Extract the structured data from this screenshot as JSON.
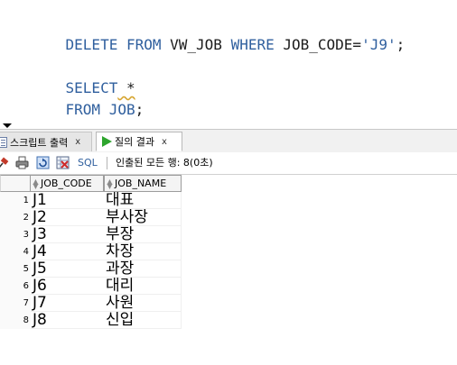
{
  "editor": {
    "line1": [
      {
        "t": "DELETE",
        "k": "kw"
      },
      {
        "t": " "
      },
      {
        "t": "FROM",
        "k": "kw"
      },
      {
        "t": " VW_JOB "
      },
      {
        "t": "WHERE",
        "k": "kw"
      },
      {
        "t": " JOB_CODE="
      },
      {
        "t": "'J9'",
        "k": "str"
      },
      {
        "t": ";"
      }
    ],
    "line2_kw": "SELECT",
    "line2_rest": " *",
    "line3_kw": "FROM",
    "line3_mid": " ",
    "line3_kw2": "JOB",
    "line3_rest": ";"
  },
  "tabs": {
    "script_output": "스크립트 출력",
    "query_result": "질의 결과",
    "close": "x"
  },
  "toolbar": {
    "sql": "SQL",
    "status": "인출된 모든 행: 8(0초)"
  },
  "grid": {
    "columns": [
      "JOB_CODE",
      "JOB_NAME"
    ],
    "rows": [
      {
        "n": "1",
        "code": "J1",
        "name": "대표"
      },
      {
        "n": "2",
        "code": "J2",
        "name": "부사장"
      },
      {
        "n": "3",
        "code": "J3",
        "name": "부장"
      },
      {
        "n": "4",
        "code": "J4",
        "name": "차장"
      },
      {
        "n": "5",
        "code": "J5",
        "name": "과장"
      },
      {
        "n": "6",
        "code": "J6",
        "name": "대리"
      },
      {
        "n": "7",
        "code": "J7",
        "name": "사원"
      },
      {
        "n": "8",
        "code": "J8",
        "name": "신입"
      }
    ]
  },
  "colors": {
    "keyword": "#2f5f9e",
    "run_icon": "#2ea52e"
  }
}
